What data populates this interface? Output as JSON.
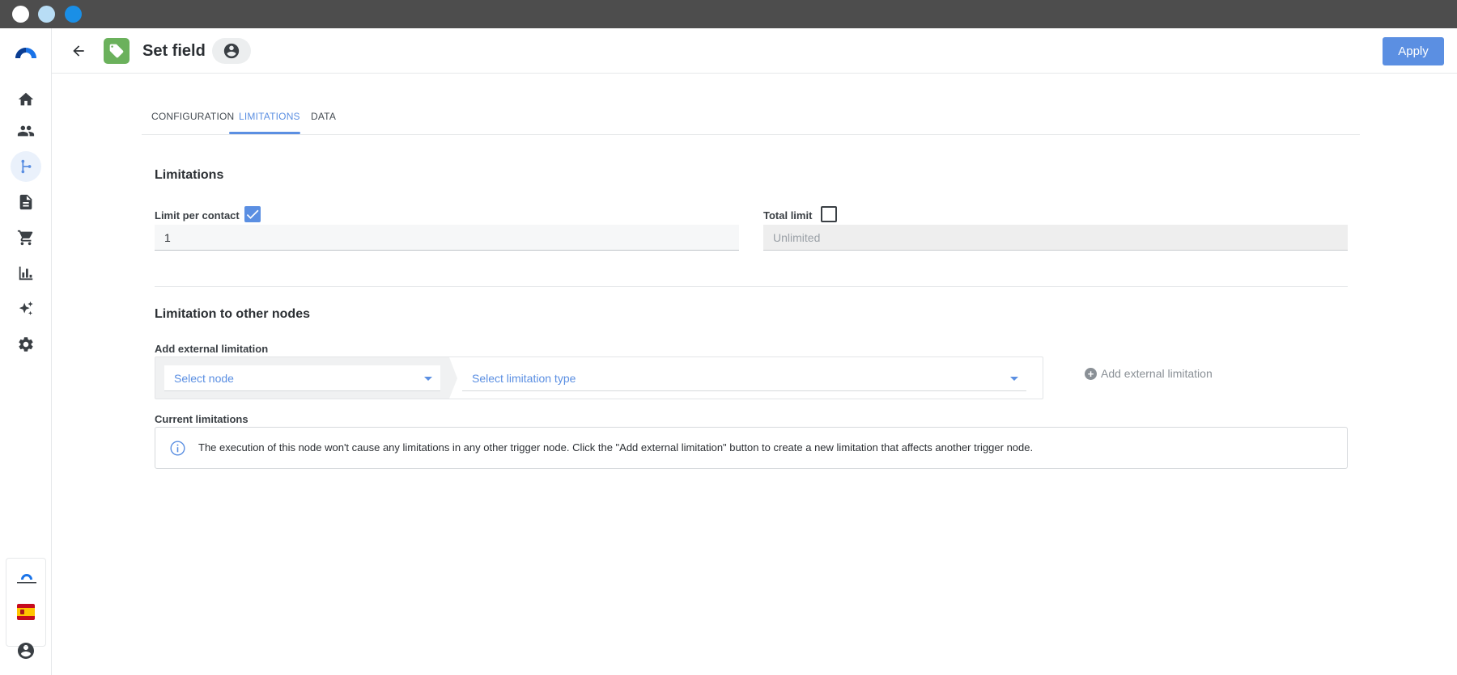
{
  "header": {
    "title": "Set field",
    "apply_label": "Apply"
  },
  "sidebar": {
    "items": [
      {
        "icon": "home-icon",
        "active": false
      },
      {
        "icon": "people-icon",
        "active": false
      },
      {
        "icon": "flow-icon",
        "active": true
      },
      {
        "icon": "document-icon",
        "active": false
      },
      {
        "icon": "cart-icon",
        "active": false
      },
      {
        "icon": "bar-chart-icon",
        "active": false
      },
      {
        "icon": "sparkles-icon",
        "active": false
      },
      {
        "icon": "gear-icon",
        "active": false
      }
    ]
  },
  "tabs": [
    {
      "label": "CONFIGURATION",
      "active": false
    },
    {
      "label": "LIMITATIONS",
      "active": true
    },
    {
      "label": "DATA",
      "active": false
    }
  ],
  "limitations": {
    "title": "Limitations",
    "per_contact_label": "Limit per contact",
    "per_contact_checked": true,
    "per_contact_value": "1",
    "total_label": "Total limit",
    "total_checked": false,
    "total_placeholder": "Unlimited"
  },
  "other_nodes": {
    "title": "Limitation to other nodes",
    "add_label": "Add external limitation",
    "select_node_placeholder": "Select node",
    "select_type_placeholder": "Select limitation type",
    "add_button_label": "Add external limitation",
    "current_label": "Current limitations",
    "info_text": "The execution of this node won't cause any limitations in any other trigger node. Click the \"Add external limitation\" button to create a new limitation that affects another trigger node."
  },
  "colors": {
    "accent": "#5b8fe2",
    "tag_green": "#6bb15c"
  }
}
